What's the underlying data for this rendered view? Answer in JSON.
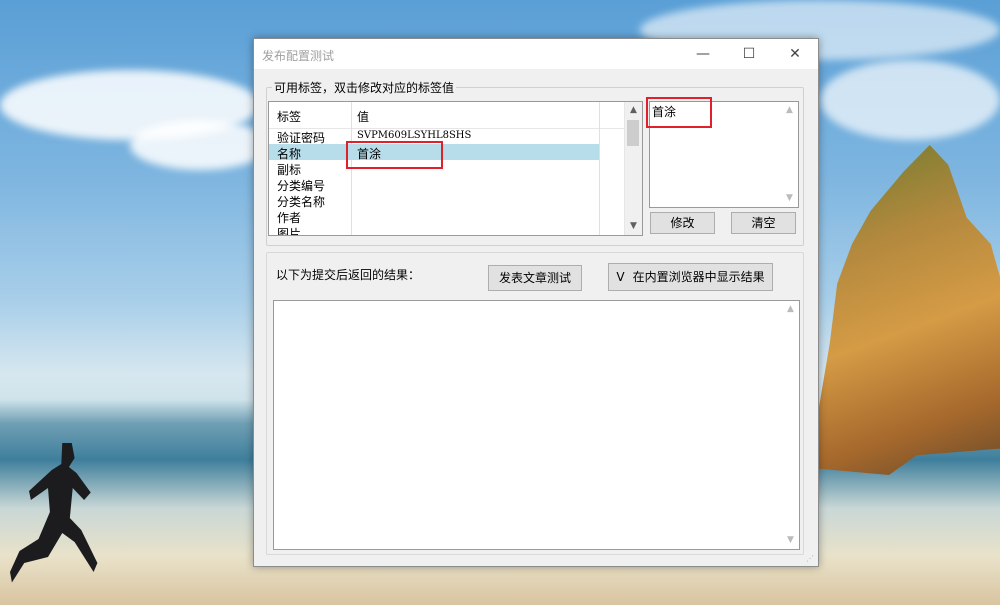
{
  "window": {
    "title": "发布配置测试",
    "minimize": "—",
    "maximize": "☐",
    "close": "✕"
  },
  "tags_group": {
    "label": "可用标签，双击修改对应的标签值",
    "columns": [
      "标签",
      "值"
    ],
    "rows": [
      {
        "tag": "验证密码",
        "value": "SVPM609LSYHL8SHS"
      },
      {
        "tag": "名称",
        "value": "首涂",
        "selected": true
      },
      {
        "tag": "副标",
        "value": ""
      },
      {
        "tag": "分类编号",
        "value": ""
      },
      {
        "tag": "分类名称",
        "value": ""
      },
      {
        "tag": "作者",
        "value": ""
      },
      {
        "tag": "图片",
        "value": ""
      }
    ]
  },
  "value_editor": {
    "value": "首涂",
    "modify_label": "修改",
    "clear_label": "清空"
  },
  "results": {
    "label": "以下为提交后返回的结果：",
    "publish_test_label": "发表文章测试",
    "browser_toggle_label": "在内置浏览器中显示结果",
    "browser_toggle_checked": true,
    "browser_toggle_mark": "V"
  },
  "icons": [
    "minimize-icon",
    "maximize-icon",
    "close-icon",
    "scroll-up-icon",
    "scroll-down-icon",
    "resize-grip-icon"
  ],
  "colors": {
    "selection": "#b7dcea",
    "highlight_box": "#e0202a"
  }
}
